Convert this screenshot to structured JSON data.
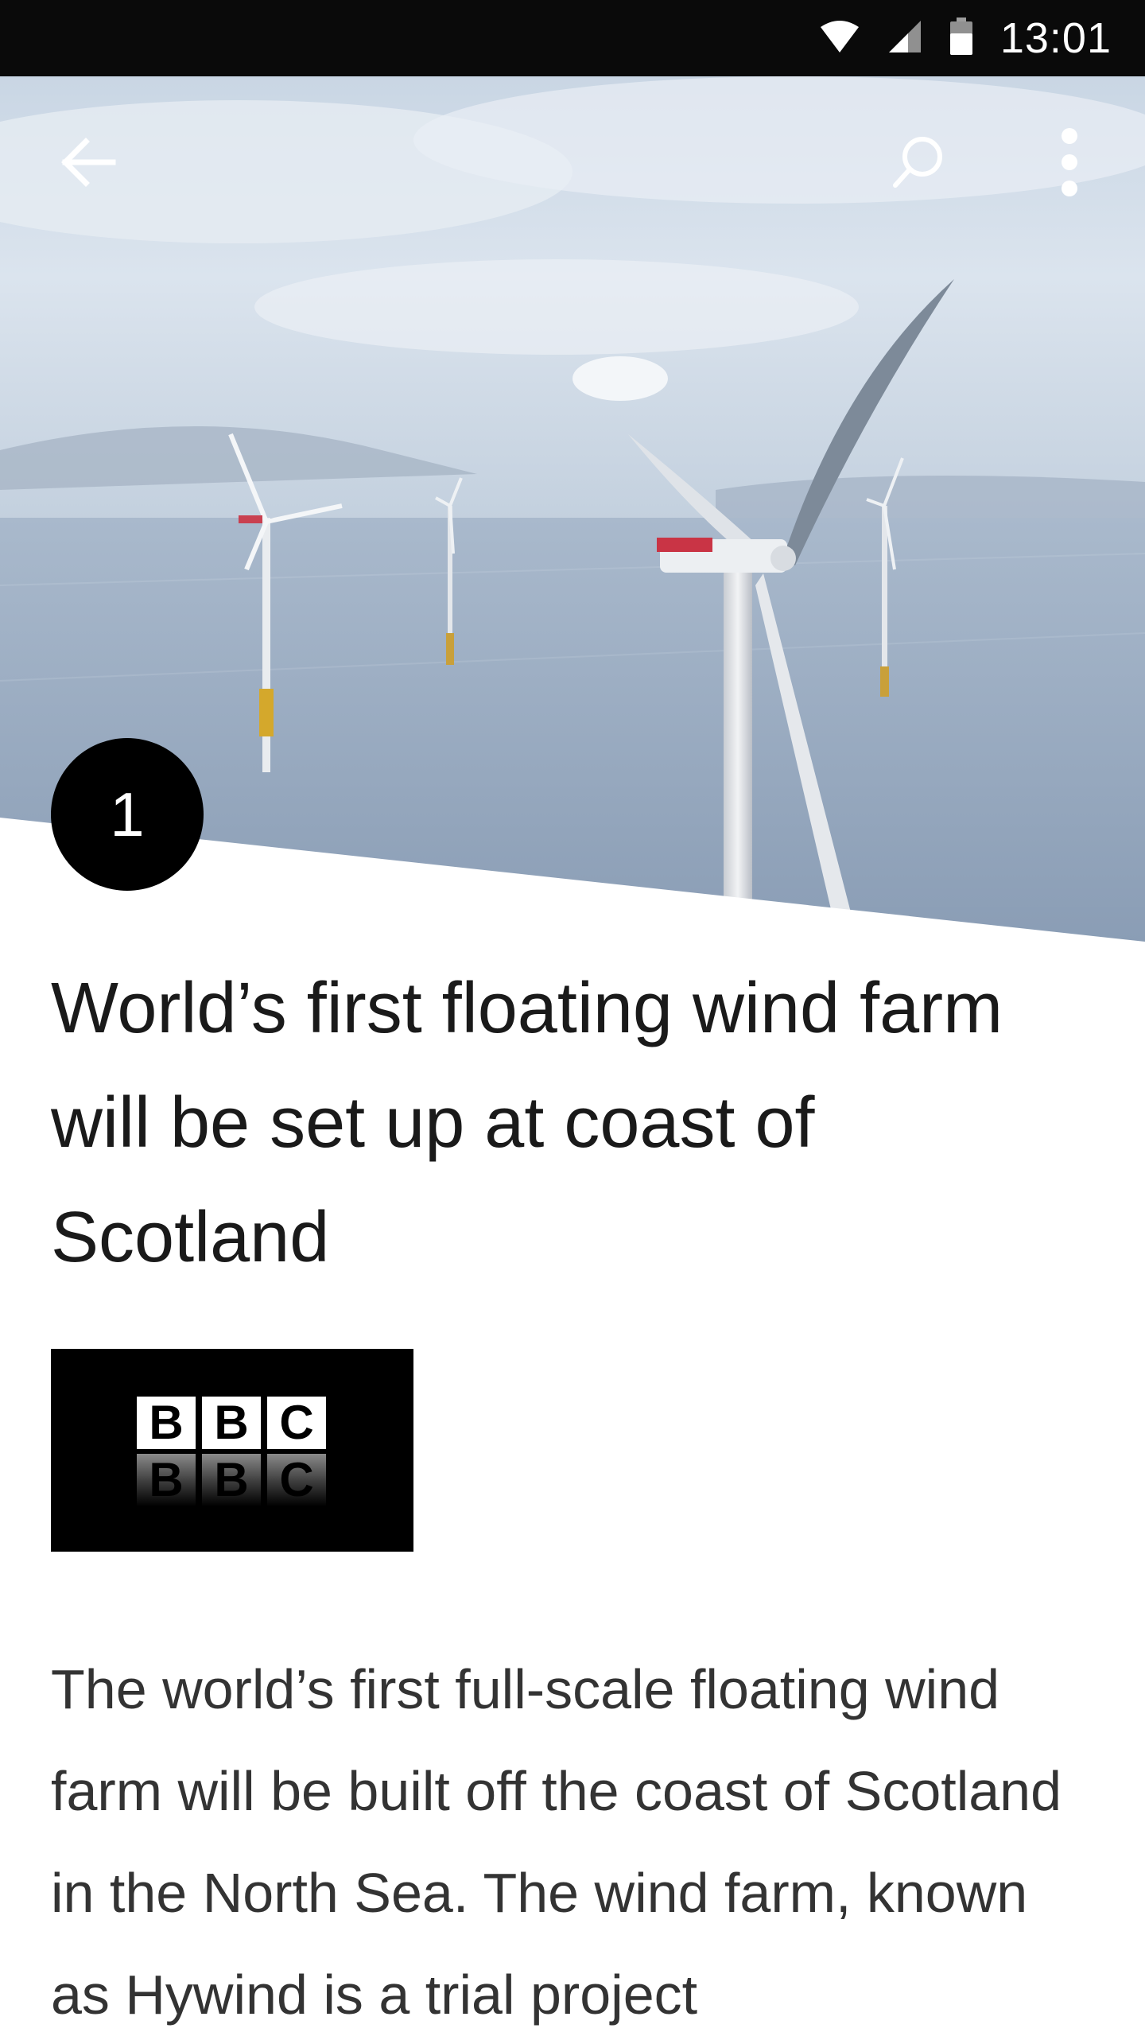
{
  "status_bar": {
    "time": "13:01",
    "icons": [
      "wifi-icon",
      "cell-signal-icon",
      "battery-icon"
    ]
  },
  "toolbar": {
    "back_icon": "arrow-left-icon",
    "search_icon": "search-icon",
    "more_icon": "more-vert-icon"
  },
  "article": {
    "rank": "1",
    "headline": "World’s first floating wind farm will be set up at coast of Scotland",
    "source_logo_text": "BBC",
    "body": "The world’s first full-scale floating wind farm will be built off the coast of Scotland in the North Sea. The wind farm, known as Hywind is a trial project"
  },
  "colors": {
    "status_bar_bg": "#0a0a0a",
    "badge_bg": "#000000",
    "headline_text": "#1a1a1a",
    "body_text": "#333333"
  }
}
